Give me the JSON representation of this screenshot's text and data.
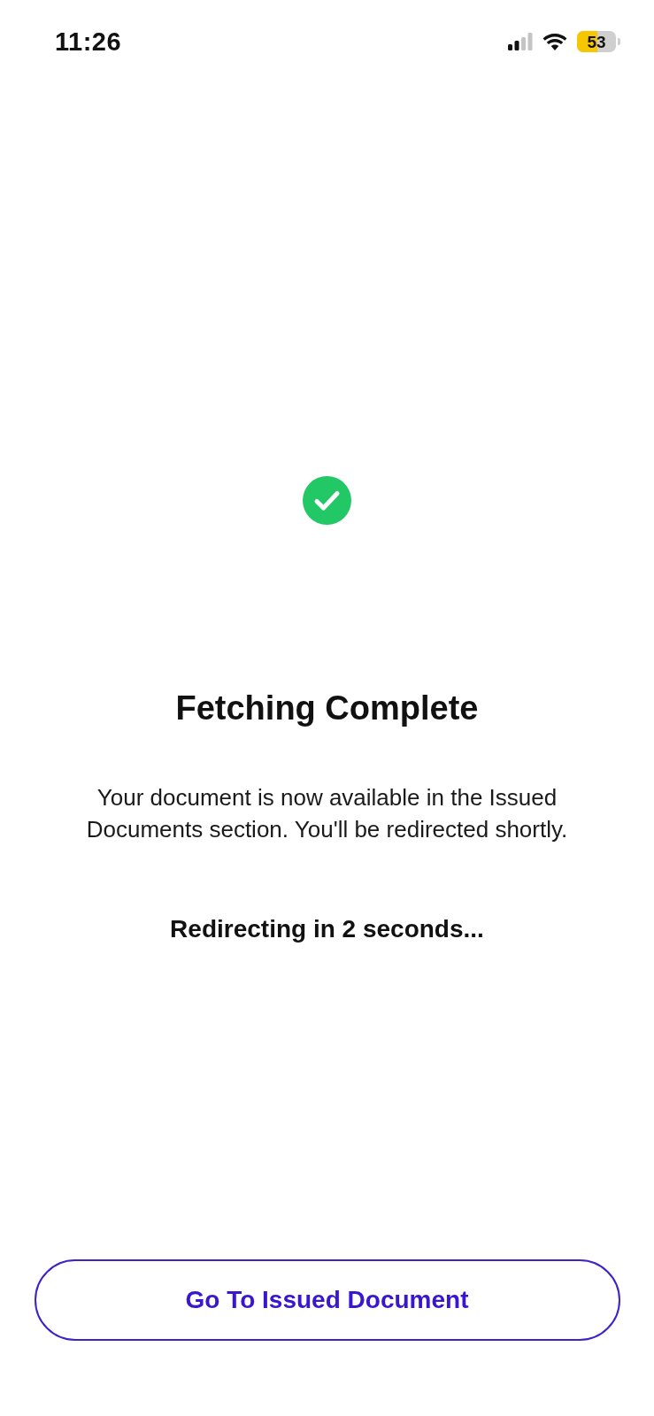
{
  "status_bar": {
    "time": "11:26",
    "battery": "53"
  },
  "title": "Fetching Complete",
  "message": "Your document is now available in the Issued Documents section. You'll be redirected shortly.",
  "countdown": "Redirecting in 2 seconds...",
  "button": {
    "label": "Go To Issued Document"
  }
}
